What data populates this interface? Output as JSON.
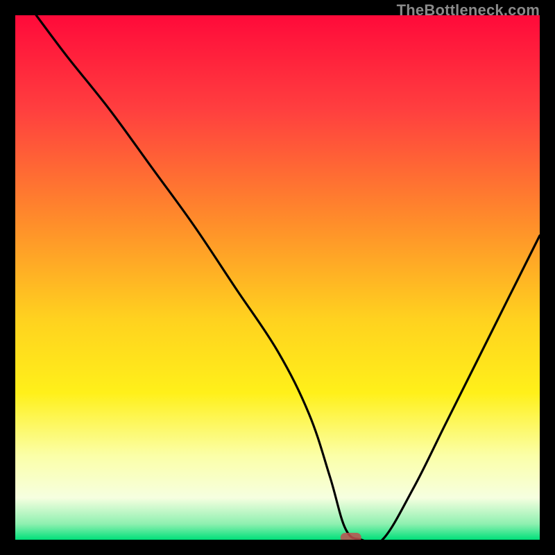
{
  "watermark": "TheBottleneck.com",
  "chart_data": {
    "type": "line",
    "title": "",
    "xlabel": "",
    "ylabel": "",
    "xlim": [
      0,
      100
    ],
    "ylim": [
      0,
      100
    ],
    "x": [
      4,
      10,
      18,
      26,
      34,
      42,
      50,
      56,
      60,
      63,
      66,
      70,
      76,
      82,
      88,
      94,
      100
    ],
    "values": [
      100,
      92,
      82,
      71,
      60,
      48,
      36,
      24,
      12,
      2,
      0,
      0,
      10,
      22,
      34,
      46,
      58
    ],
    "curve_description": "V-shaped bottleneck curve with minimum around x≈63–70 (y≈0) rising steeply on both sides",
    "marker": {
      "x": 64,
      "y": 0,
      "shape": "pill",
      "color": "#c05050"
    },
    "gradient_stops": [
      {
        "pct": 0,
        "color": "#ff0a3a"
      },
      {
        "pct": 18,
        "color": "#ff3f3f"
      },
      {
        "pct": 40,
        "color": "#ff8f2a"
      },
      {
        "pct": 58,
        "color": "#ffd21f"
      },
      {
        "pct": 72,
        "color": "#fff01a"
      },
      {
        "pct": 84,
        "color": "#fbffa8"
      },
      {
        "pct": 92,
        "color": "#f6ffe0"
      },
      {
        "pct": 97,
        "color": "#8ef0b0"
      },
      {
        "pct": 100,
        "color": "#00e07a"
      }
    ]
  }
}
